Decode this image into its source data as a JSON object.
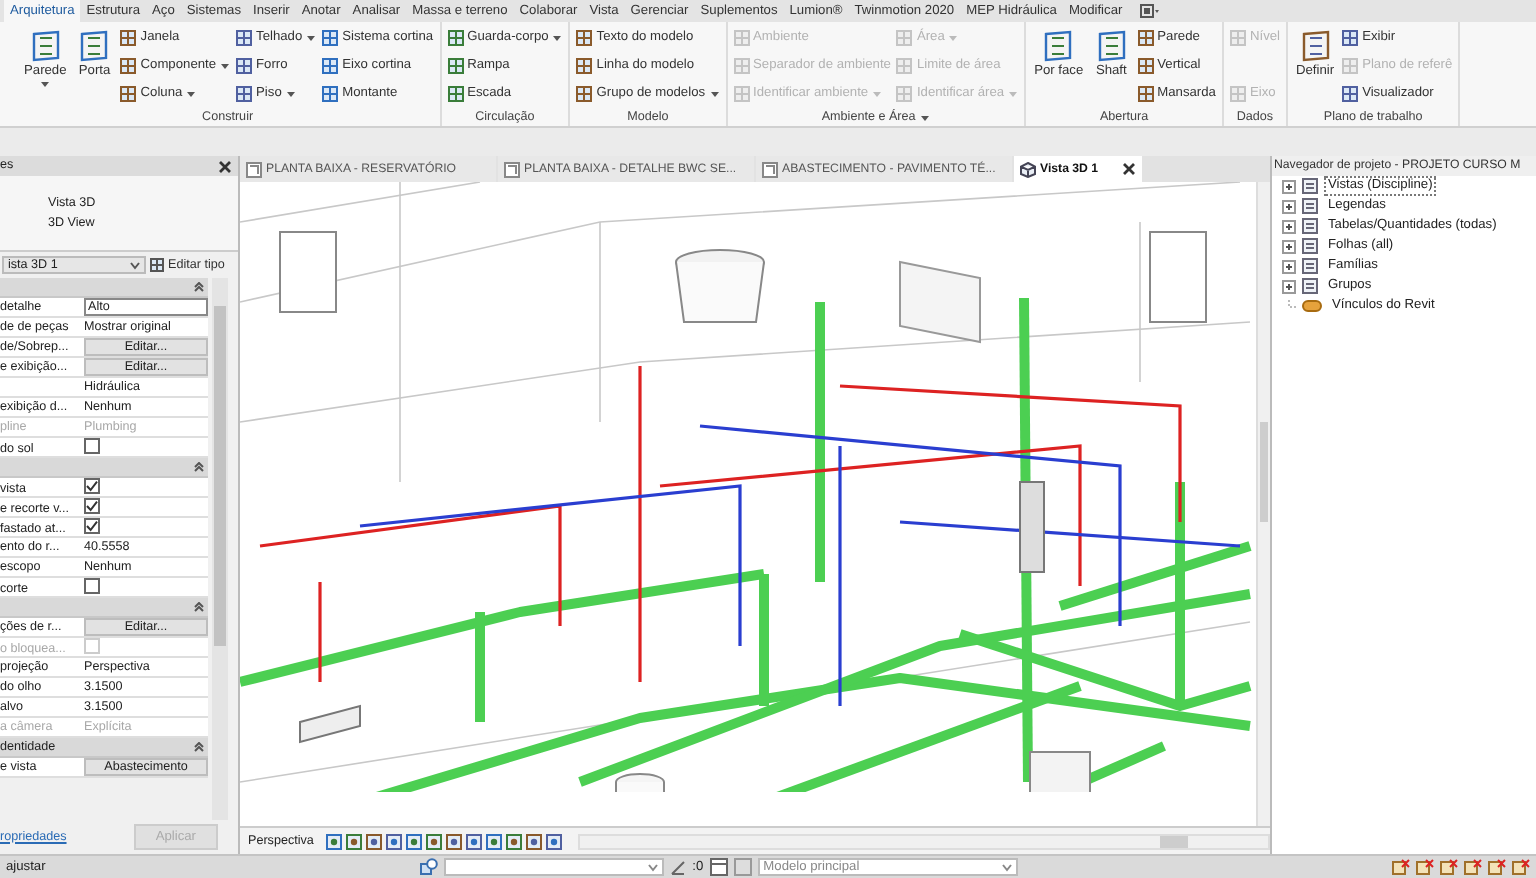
{
  "ribbon": {
    "tabs": [
      {
        "label": "Arquitetura",
        "selected": true
      },
      {
        "label": "Estrutura",
        "selected": false
      },
      {
        "label": "Aço",
        "selected": false
      },
      {
        "label": "Sistemas",
        "selected": false
      },
      {
        "label": "Inserir",
        "selected": false
      },
      {
        "label": "Anotar",
        "selected": false
      },
      {
        "label": "Analisar",
        "selected": false
      },
      {
        "label": "Massa e terreno",
        "selected": false
      },
      {
        "label": "Colaborar",
        "selected": false
      },
      {
        "label": "Vista",
        "selected": false
      },
      {
        "label": "Gerenciar",
        "selected": false
      },
      {
        "label": "Suplementos",
        "selected": false
      },
      {
        "label": "Lumion®",
        "selected": false
      },
      {
        "label": "Twinmotion 2020",
        "selected": false
      },
      {
        "label": "MEP Hidráulica",
        "selected": false
      },
      {
        "label": "Modificar",
        "selected": false
      }
    ],
    "groups": [
      {
        "label": "Construir",
        "menu": false,
        "columns": [
          {
            "kind": "large",
            "items": [
              {
                "label": "Parede",
                "menu": true,
                "disabled": false
              }
            ]
          },
          {
            "kind": "large",
            "items": [
              {
                "label": "Porta",
                "menu": false,
                "disabled": false
              }
            ]
          },
          {
            "kind": "small",
            "items": [
              {
                "label": "Janela",
                "menu": false,
                "disabled": false
              },
              {
                "label": "Componente",
                "menu": true,
                "disabled": false
              },
              {
                "label": "Coluna",
                "menu": true,
                "disabled": false
              }
            ]
          },
          {
            "kind": "small",
            "items": [
              {
                "label": "Telhado",
                "menu": true,
                "disabled": false
              },
              {
                "label": "Forro",
                "menu": false,
                "disabled": false
              },
              {
                "label": "Piso",
                "menu": true,
                "disabled": false
              }
            ]
          },
          {
            "kind": "small",
            "items": [
              {
                "label": "Sistema cortina",
                "menu": false,
                "disabled": false
              },
              {
                "label": "Eixo cortina",
                "menu": false,
                "disabled": false
              },
              {
                "label": "Montante",
                "menu": false,
                "disabled": false
              }
            ]
          }
        ]
      },
      {
        "label": "Circulação",
        "menu": false,
        "columns": [
          {
            "kind": "small",
            "items": [
              {
                "label": "Guarda-corpo",
                "menu": true,
                "disabled": false
              },
              {
                "label": "Rampa",
                "menu": false,
                "disabled": false
              },
              {
                "label": "Escada",
                "menu": false,
                "disabled": false
              }
            ]
          }
        ]
      },
      {
        "label": "Modelo",
        "menu": false,
        "columns": [
          {
            "kind": "small",
            "items": [
              {
                "label": "Texto do modelo",
                "menu": false,
                "disabled": false
              },
              {
                "label": "Linha do modelo",
                "menu": false,
                "disabled": false
              },
              {
                "label": "Grupo de modelos",
                "menu": true,
                "disabled": false
              }
            ]
          }
        ]
      },
      {
        "label": "Ambiente e Área",
        "menu": true,
        "columns": [
          {
            "kind": "small",
            "items": [
              {
                "label": "Ambiente",
                "menu": false,
                "disabled": true
              },
              {
                "label": "Separador de ambiente",
                "menu": false,
                "disabled": true
              },
              {
                "label": "Identificar ambiente",
                "menu": true,
                "disabled": true
              }
            ]
          },
          {
            "kind": "small",
            "items": [
              {
                "label": "Área",
                "menu": true,
                "disabled": true
              },
              {
                "label": "Limite de área",
                "menu": false,
                "disabled": true
              },
              {
                "label": "Identificar área",
                "menu": true,
                "disabled": true
              }
            ]
          }
        ]
      },
      {
        "label": "Abertura",
        "menu": false,
        "columns": [
          {
            "kind": "large",
            "items": [
              {
                "label": "Por face",
                "menu": false,
                "disabled": false
              }
            ]
          },
          {
            "kind": "large",
            "items": [
              {
                "label": "Shaft",
                "menu": false,
                "disabled": false
              }
            ]
          },
          {
            "kind": "small",
            "items": [
              {
                "label": "Parede",
                "menu": false,
                "disabled": false
              },
              {
                "label": "Vertical",
                "menu": false,
                "disabled": false
              },
              {
                "label": "Mansarda",
                "menu": false,
                "disabled": false
              }
            ]
          }
        ]
      },
      {
        "label": "Dados",
        "menu": false,
        "columns": [
          {
            "kind": "small",
            "items": [
              {
                "label": "Nível",
                "menu": false,
                "disabled": true
              },
              {
                "label": "Eixo",
                "menu": false,
                "disabled": true
              }
            ]
          }
        ]
      },
      {
        "label": "Plano de trabalho",
        "menu": false,
        "columns": [
          {
            "kind": "large",
            "items": [
              {
                "label": "Definir",
                "menu": false,
                "disabled": false
              }
            ]
          },
          {
            "kind": "small",
            "items": [
              {
                "label": "Exibir",
                "menu": false,
                "disabled": false
              },
              {
                "label": "Plano de referê",
                "menu": false,
                "disabled": true
              },
              {
                "label": "Visualizador",
                "menu": false,
                "disabled": false
              }
            ]
          }
        ]
      }
    ]
  },
  "properties": {
    "title": "es",
    "type_name": "Vista 3D",
    "type_subname": "3D View",
    "instance": "ista 3D 1",
    "edit_type": "Editar tipo",
    "rows": [
      {
        "kind": "input",
        "label": "detalhe",
        "value": "Alto",
        "disabled": false
      },
      {
        "kind": "text",
        "label": "de de peças",
        "value": "Mostrar original",
        "disabled": false
      },
      {
        "kind": "button",
        "label": "de/Sobrep...",
        "value": "Editar...",
        "disabled": false
      },
      {
        "kind": "button",
        "label": "e exibição...",
        "value": "Editar...",
        "disabled": false
      },
      {
        "kind": "text",
        "value": "Hidráulica",
        "disabled": false
      },
      {
        "kind": "text",
        "label": "exibição d...",
        "value": "Nenhum",
        "disabled": false
      },
      {
        "kind": "text",
        "label": "pline",
        "value": "Plumbing",
        "disabled": true
      },
      {
        "kind": "checkbox",
        "label": "do sol",
        "checked": false,
        "disabled": false
      },
      {
        "kind": "section"
      },
      {
        "kind": "checkbox",
        "label": "vista",
        "checked": true,
        "disabled": false
      },
      {
        "kind": "checkbox",
        "label": "e recorte v...",
        "checked": true,
        "disabled": false
      },
      {
        "kind": "checkbox",
        "label": "fastado at...",
        "checked": true,
        "disabled": false
      },
      {
        "kind": "text",
        "label": "ento do r...",
        "value": "40.5558",
        "disabled": false
      },
      {
        "kind": "text",
        "label": "escopo",
        "value": "Nenhum",
        "disabled": false
      },
      {
        "kind": "checkbox",
        "label": "corte",
        "checked": false,
        "disabled": false
      },
      {
        "kind": "section"
      },
      {
        "kind": "button",
        "label": "ções de r...",
        "value": "Editar...",
        "disabled": false
      },
      {
        "kind": "checkbox",
        "label": "o bloquea...",
        "checked": false,
        "disabled": true
      },
      {
        "kind": "text",
        "label": "projeção",
        "value": "Perspectiva",
        "disabled": false
      },
      {
        "kind": "text",
        "label": "do olho",
        "value": "3.1500",
        "disabled": false
      },
      {
        "kind": "text",
        "label": "alvo",
        "value": "3.1500",
        "disabled": false
      },
      {
        "kind": "text",
        "label": "a câmera",
        "value": "Explícita",
        "disabled": true
      },
      {
        "kind": "section",
        "label": "dentidade"
      },
      {
        "kind": "button",
        "label": "e vista",
        "value": "Abastecimento",
        "disabled": false
      }
    ],
    "help_link": "ropriedades",
    "apply": {
      "label": "Aplicar",
      "disabled": true
    }
  },
  "view_tabs": [
    {
      "label": "PLANTA BAIXA - RESERVATÓRIO",
      "kind": "plan",
      "selected": false
    },
    {
      "label": "PLANTA BAIXA - DETALHE BWC SE...",
      "kind": "plan",
      "selected": false
    },
    {
      "label": "ABASTECIMENTO - PAVIMENTO TÉ...",
      "kind": "plan",
      "selected": false
    },
    {
      "label": "Vista 3D 1",
      "kind": "perspective",
      "selected": true
    }
  ],
  "view_bar": {
    "label": "Perspectiva"
  },
  "browser": {
    "title": "Navegador de projeto - PROJETO CURSO M",
    "items": [
      {
        "label": "Vistas (Discipline)",
        "expandable": true,
        "selected": true
      },
      {
        "label": "Legendas",
        "expandable": true,
        "selected": false
      },
      {
        "label": "Tabelas/Quantidades (todas)",
        "expandable": true,
        "selected": false
      },
      {
        "label": "Folhas (all)",
        "expandable": true,
        "selected": false
      },
      {
        "label": "Famílias",
        "expandable": true,
        "selected": false
      },
      {
        "label": "Grupos",
        "expandable": true,
        "selected": false
      },
      {
        "label": "Vínculos do Revit",
        "expandable": false,
        "selected": false
      }
    ]
  },
  "status_bar": {
    "text": "ajustar",
    "count": ":0",
    "model": "Modelo principal"
  }
}
